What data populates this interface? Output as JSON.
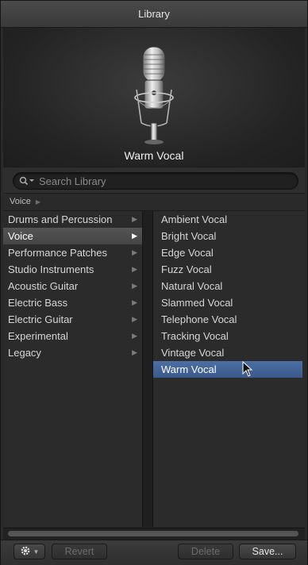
{
  "window": {
    "title": "Library"
  },
  "preview": {
    "patch_name": "Warm Vocal",
    "icon": "microphone-icon"
  },
  "search": {
    "placeholder": "Search Library",
    "value": ""
  },
  "breadcrumb": {
    "path": "Voice"
  },
  "categories": [
    {
      "label": "Drums and Percussion",
      "selected": false
    },
    {
      "label": "Voice",
      "selected": true
    },
    {
      "label": "Performance Patches",
      "selected": false
    },
    {
      "label": "Studio Instruments",
      "selected": false
    },
    {
      "label": "Acoustic Guitar",
      "selected": false
    },
    {
      "label": "Electric Bass",
      "selected": false
    },
    {
      "label": "Electric Guitar",
      "selected": false
    },
    {
      "label": "Experimental",
      "selected": false
    },
    {
      "label": "Legacy",
      "selected": false
    }
  ],
  "patches": [
    {
      "label": "Ambient Vocal",
      "selected": false
    },
    {
      "label": "Bright Vocal",
      "selected": false
    },
    {
      "label": "Edge Vocal",
      "selected": false
    },
    {
      "label": "Fuzz Vocal",
      "selected": false
    },
    {
      "label": "Natural Vocal",
      "selected": false
    },
    {
      "label": "Slammed Vocal",
      "selected": false
    },
    {
      "label": "Telephone Vocal",
      "selected": false
    },
    {
      "label": "Tracking Vocal",
      "selected": false
    },
    {
      "label": "Vintage Vocal",
      "selected": false
    },
    {
      "label": "Warm Vocal",
      "selected": true
    }
  ],
  "footer": {
    "action_icon": "gear-icon",
    "revert_label": "Revert",
    "delete_label": "Delete",
    "save_label": "Save..."
  },
  "colors": {
    "selection_blue": "#3f5f92",
    "selection_gray": "#4c4c4c",
    "background": "#2b2b2b"
  }
}
